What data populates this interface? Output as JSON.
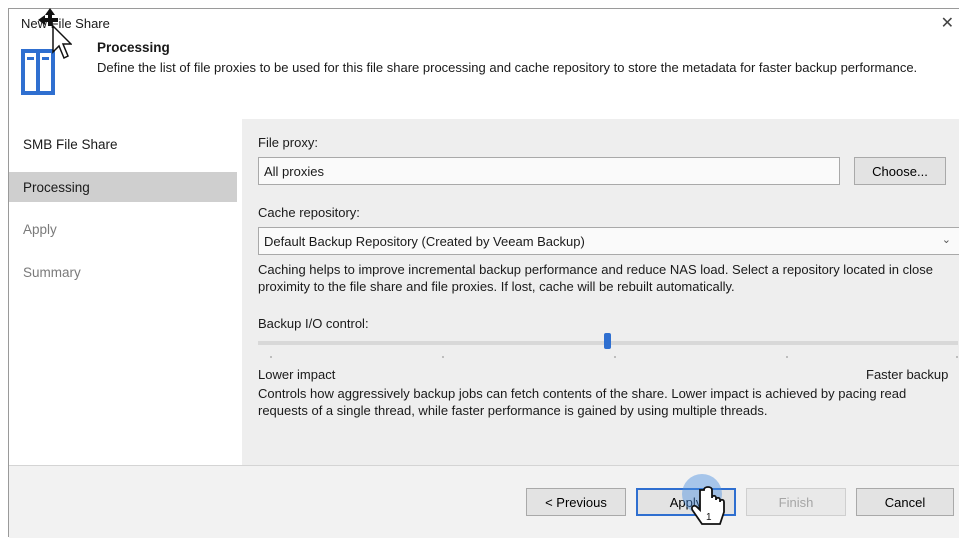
{
  "window": {
    "title": "New File Share",
    "close_label": "✕"
  },
  "header": {
    "step_title": "Processing",
    "description": "Define the list of file proxies to be used for this file share processing and cache repository to store the metadata for faster backup performance."
  },
  "sidebar": {
    "items": [
      {
        "label": "SMB File Share",
        "state": "normal"
      },
      {
        "label": "Processing",
        "state": "selected"
      },
      {
        "label": "Apply",
        "state": "disabled"
      },
      {
        "label": "Summary",
        "state": "disabled"
      }
    ]
  },
  "main": {
    "file_proxy_label": "File proxy:",
    "file_proxy_value": "All proxies",
    "choose_button": "Choose...",
    "cache_repository_label": "Cache repository:",
    "cache_repository_value": "Default Backup Repository (Created by Veeam Backup)",
    "cache_help": "Caching helps to improve incremental backup performance and reduce NAS load. Select a repository located in close proximity to the file share and file proxies. If lost, cache will be rebuilt automatically.",
    "backup_io_label": "Backup I/O control:",
    "slider_min_label": "Lower impact",
    "slider_max_label": "Faster backup",
    "slider_level": 0.5,
    "io_help": "Controls how aggressively backup jobs can fetch contents of the share. Lower impact is achieved by pacing read requests of a single thread, while faster performance is gained by using multiple threads."
  },
  "footer": {
    "previous_button": "< Previous",
    "apply_button": "Apply",
    "finish_button": "Finish",
    "cancel_button": "Cancel"
  },
  "colors": {
    "accent": "#2f6fd0",
    "selected_nav": "#cfcfcf",
    "panel": "#eeeeee"
  }
}
